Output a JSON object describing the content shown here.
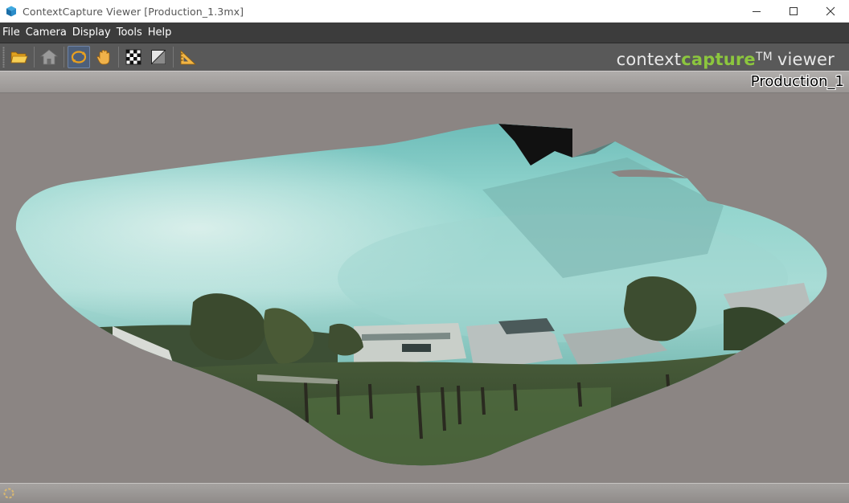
{
  "window": {
    "title": "ContextCapture Viewer [Production_1.3mx]",
    "icons": {
      "app": "app-cube-icon",
      "minimize": "minimize-icon",
      "maximize": "maximize-icon",
      "close": "close-icon"
    }
  },
  "menu": {
    "items": [
      {
        "label": "File"
      },
      {
        "label": "Camera"
      },
      {
        "label": "Display"
      },
      {
        "label": "Tools"
      },
      {
        "label": "Help"
      }
    ]
  },
  "toolbar": {
    "buttons": [
      {
        "icon": "open-folder-icon",
        "active": false
      },
      {
        "icon": "home-icon",
        "active": false
      },
      {
        "icon": "orbit-icon",
        "active": true
      },
      {
        "icon": "pan-hand-icon",
        "active": false
      },
      {
        "icon": "checker-texture-icon",
        "active": false
      },
      {
        "icon": "shading-icon",
        "active": false
      },
      {
        "icon": "measure-triangle-icon",
        "active": false
      }
    ],
    "brand": {
      "part1": "context",
      "part2": "capture",
      "tm": "TM",
      "part3": "viewer"
    },
    "accent_color": "#8cc63e"
  },
  "viewport": {
    "model_name": "Production_1",
    "background_color": "#8b8583"
  },
  "statusbar": {
    "icon": "loading-spinner-icon"
  }
}
